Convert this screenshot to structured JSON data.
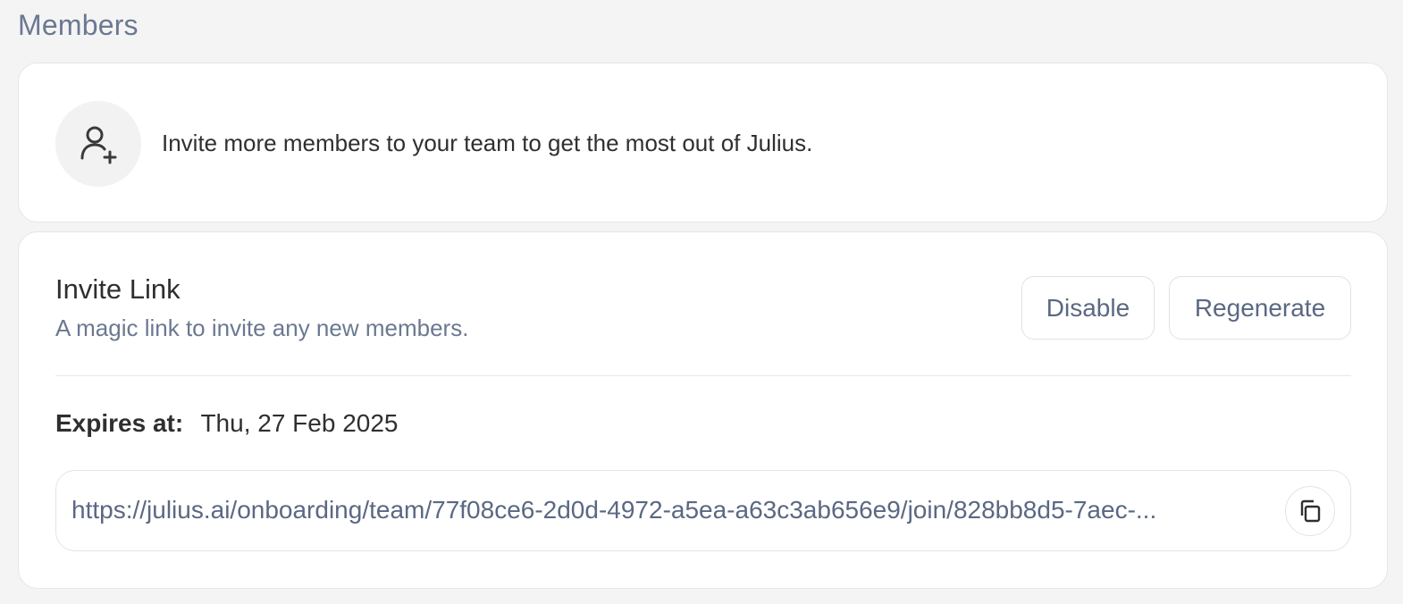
{
  "page": {
    "title": "Members"
  },
  "invite_banner": {
    "icon": "user-plus-icon",
    "text": "Invite more members to your team to get the most out of Julius."
  },
  "invite_link": {
    "title": "Invite Link",
    "subtitle": "A magic link to invite any new members.",
    "buttons": {
      "disable": "Disable",
      "regenerate": "Regenerate"
    },
    "expires_label": "Expires at:",
    "expires_value": "Thu, 27 Feb 2025",
    "url": "https://julius.ai/onboarding/team/77f08ce6-2d0d-4972-a5ea-a63c3ab656e9/join/828bb8d5-7aec-...",
    "copy_icon": "copy-icon"
  },
  "colors": {
    "background": "#f4f4f4",
    "card": "#ffffff",
    "muted_text": "#6b7891",
    "text": "#2f2f2f",
    "border": "#e4e6ea"
  }
}
